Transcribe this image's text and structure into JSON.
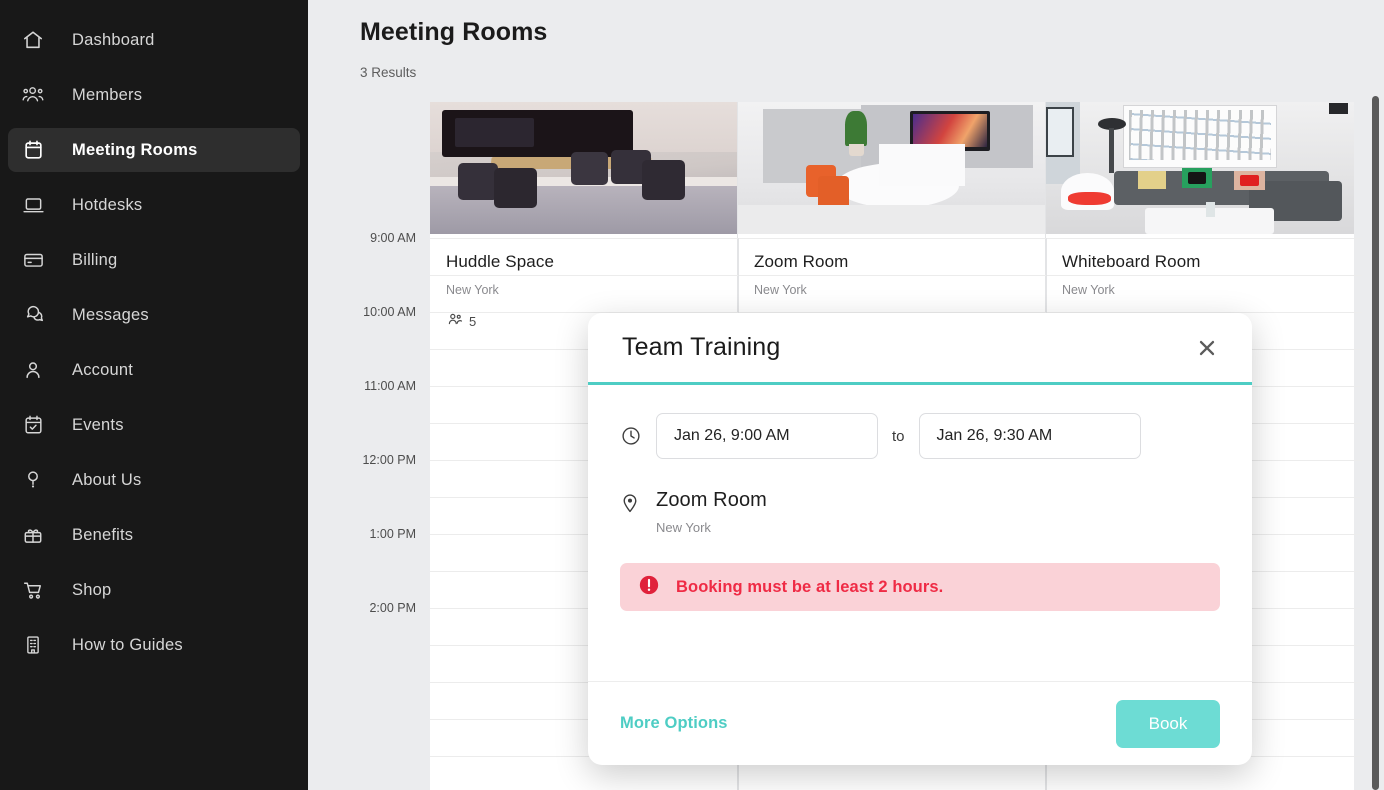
{
  "sidebar": {
    "items": [
      {
        "label": "Dashboard",
        "icon": "home-icon",
        "active": false
      },
      {
        "label": "Members",
        "icon": "users-icon",
        "active": false
      },
      {
        "label": "Meeting Rooms",
        "icon": "calendar-icon",
        "active": true
      },
      {
        "label": "Hotdesks",
        "icon": "laptop-icon",
        "active": false
      },
      {
        "label": "Billing",
        "icon": "card-icon",
        "active": false
      },
      {
        "label": "Messages",
        "icon": "chat-icon",
        "active": false
      },
      {
        "label": "Account",
        "icon": "person-icon",
        "active": false
      },
      {
        "label": "Events",
        "icon": "event-icon",
        "active": false
      },
      {
        "label": "About Us",
        "icon": "question-icon",
        "active": false
      },
      {
        "label": "Benefits",
        "icon": "gift-icon",
        "active": false
      },
      {
        "label": "Shop",
        "icon": "cart-icon",
        "active": false
      },
      {
        "label": "How to Guides",
        "icon": "building-icon",
        "active": false
      }
    ]
  },
  "header": {
    "title": "Meeting Rooms",
    "results": "3 Results"
  },
  "rooms": [
    {
      "name": "Huddle Space",
      "location": "New York",
      "capacity": "5",
      "capacity_icon": "people-icon"
    },
    {
      "name": "Zoom Room",
      "location": "New York",
      "capacity": "",
      "capacity_icon": "people-icon"
    },
    {
      "name": "Whiteboard Room",
      "location": "New York",
      "capacity": "",
      "capacity_icon": "people-icon"
    }
  ],
  "calendar": {
    "times": [
      "9:00 AM",
      "10:00 AM",
      "11:00 AM",
      "12:00 PM",
      "1:00 PM",
      "2:00 PM"
    ]
  },
  "modal": {
    "title": "Team Training",
    "close_icon": "close-icon",
    "clock_icon": "clock-icon",
    "pin_icon": "location-pin-icon",
    "start_time": "Jan 26, 9:00 AM",
    "end_time": "Jan 26, 9:30 AM",
    "to_label": "to",
    "room_name": "Zoom Room",
    "room_location": "New York",
    "error_icon": "error-exclamation-icon",
    "error_message": "Booking must be at least 2 hours.",
    "more_options_label": "More Options",
    "book_label": "Book"
  },
  "colors": {
    "accent_teal": "#4ecdc4",
    "book_button": "#6ddcd4",
    "error_text": "#ef2b45",
    "error_bg": "#fad2d7",
    "sidebar_bg": "#181818",
    "sidebar_active": "#2e2e2e",
    "canvas_bg": "#ebecee"
  }
}
